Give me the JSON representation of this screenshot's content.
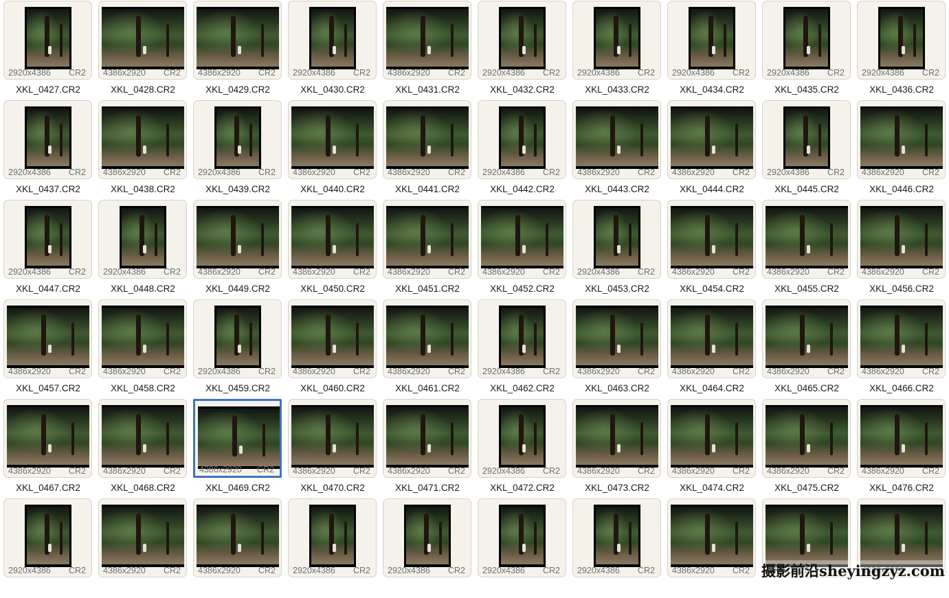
{
  "items": [
    {
      "filename": "XKL_0427.CR2",
      "dimensions": "2920x4386",
      "format": "CR2",
      "orientation": "portrait",
      "selected": false
    },
    {
      "filename": "XKL_0428.CR2",
      "dimensions": "4386x2920",
      "format": "CR2",
      "orientation": "landscape",
      "selected": false
    },
    {
      "filename": "XKL_0429.CR2",
      "dimensions": "4386x2920",
      "format": "CR2",
      "orientation": "landscape",
      "selected": false
    },
    {
      "filename": "XKL_0430.CR2",
      "dimensions": "2920x4386",
      "format": "CR2",
      "orientation": "portrait",
      "selected": false
    },
    {
      "filename": "XKL_0431.CR2",
      "dimensions": "4386x2920",
      "format": "CR2",
      "orientation": "landscape",
      "selected": false
    },
    {
      "filename": "XKL_0432.CR2",
      "dimensions": "2920x4386",
      "format": "CR2",
      "orientation": "portrait",
      "selected": false
    },
    {
      "filename": "XKL_0433.CR2",
      "dimensions": "2920x4386",
      "format": "CR2",
      "orientation": "portrait",
      "selected": false
    },
    {
      "filename": "XKL_0434.CR2",
      "dimensions": "2920x4386",
      "format": "CR2",
      "orientation": "portrait",
      "selected": false
    },
    {
      "filename": "XKL_0435.CR2",
      "dimensions": "2920x4386",
      "format": "CR2",
      "orientation": "portrait",
      "selected": false
    },
    {
      "filename": "XKL_0436.CR2",
      "dimensions": "2920x4386",
      "format": "CR2",
      "orientation": "portrait",
      "selected": false
    },
    {
      "filename": "XKL_0437.CR2",
      "dimensions": "2920x4386",
      "format": "CR2",
      "orientation": "portrait",
      "selected": false
    },
    {
      "filename": "XKL_0438.CR2",
      "dimensions": "4386x2920",
      "format": "CR2",
      "orientation": "landscape",
      "selected": false
    },
    {
      "filename": "XKL_0439.CR2",
      "dimensions": "2920x4386",
      "format": "CR2",
      "orientation": "portrait",
      "selected": false
    },
    {
      "filename": "XKL_0440.CR2",
      "dimensions": "4386x2920",
      "format": "CR2",
      "orientation": "landscape",
      "selected": false
    },
    {
      "filename": "XKL_0441.CR2",
      "dimensions": "4386x2920",
      "format": "CR2",
      "orientation": "landscape",
      "selected": false
    },
    {
      "filename": "XKL_0442.CR2",
      "dimensions": "2920x4386",
      "format": "CR2",
      "orientation": "portrait",
      "selected": false
    },
    {
      "filename": "XKL_0443.CR2",
      "dimensions": "4386x2920",
      "format": "CR2",
      "orientation": "landscape",
      "selected": false
    },
    {
      "filename": "XKL_0444.CR2",
      "dimensions": "4386x2920",
      "format": "CR2",
      "orientation": "landscape",
      "selected": false
    },
    {
      "filename": "XKL_0445.CR2",
      "dimensions": "2920x4386",
      "format": "CR2",
      "orientation": "portrait",
      "selected": false
    },
    {
      "filename": "XKL_0446.CR2",
      "dimensions": "4386x2920",
      "format": "CR2",
      "orientation": "landscape",
      "selected": false
    },
    {
      "filename": "XKL_0447.CR2",
      "dimensions": "2920x4386",
      "format": "CR2",
      "orientation": "portrait",
      "selected": false
    },
    {
      "filename": "XKL_0448.CR2",
      "dimensions": "2920x4386",
      "format": "CR2",
      "orientation": "portrait",
      "selected": false
    },
    {
      "filename": "XKL_0449.CR2",
      "dimensions": "4386x2920",
      "format": "CR2",
      "orientation": "landscape",
      "selected": false
    },
    {
      "filename": "XKL_0450.CR2",
      "dimensions": "4386x2920",
      "format": "CR2",
      "orientation": "landscape",
      "selected": false
    },
    {
      "filename": "XKL_0451.CR2",
      "dimensions": "4386x2920",
      "format": "CR2",
      "orientation": "landscape",
      "selected": false
    },
    {
      "filename": "XKL_0452.CR2",
      "dimensions": "4386x2920",
      "format": "CR2",
      "orientation": "landscape",
      "selected": false
    },
    {
      "filename": "XKL_0453.CR2",
      "dimensions": "2920x4386",
      "format": "CR2",
      "orientation": "portrait",
      "selected": false
    },
    {
      "filename": "XKL_0454.CR2",
      "dimensions": "4386x2920",
      "format": "CR2",
      "orientation": "landscape",
      "selected": false
    },
    {
      "filename": "XKL_0455.CR2",
      "dimensions": "4386x2920",
      "format": "CR2",
      "orientation": "landscape",
      "selected": false
    },
    {
      "filename": "XKL_0456.CR2",
      "dimensions": "4386x2920",
      "format": "CR2",
      "orientation": "landscape",
      "selected": false
    },
    {
      "filename": "XKL_0457.CR2",
      "dimensions": "4386x2920",
      "format": "CR2",
      "orientation": "landscape",
      "selected": false
    },
    {
      "filename": "XKL_0458.CR2",
      "dimensions": "4386x2920",
      "format": "CR2",
      "orientation": "landscape",
      "selected": false
    },
    {
      "filename": "XKL_0459.CR2",
      "dimensions": "2920x4386",
      "format": "CR2",
      "orientation": "portrait",
      "selected": false
    },
    {
      "filename": "XKL_0460.CR2",
      "dimensions": "4386x2920",
      "format": "CR2",
      "orientation": "landscape",
      "selected": false
    },
    {
      "filename": "XKL_0461.CR2",
      "dimensions": "4386x2920",
      "format": "CR2",
      "orientation": "landscape",
      "selected": false
    },
    {
      "filename": "XKL_0462.CR2",
      "dimensions": "2920x4386",
      "format": "CR2",
      "orientation": "portrait",
      "selected": false
    },
    {
      "filename": "XKL_0463.CR2",
      "dimensions": "4386x2920",
      "format": "CR2",
      "orientation": "landscape",
      "selected": false
    },
    {
      "filename": "XKL_0464.CR2",
      "dimensions": "4386x2920",
      "format": "CR2",
      "orientation": "landscape",
      "selected": false
    },
    {
      "filename": "XKL_0465.CR2",
      "dimensions": "4386x2920",
      "format": "CR2",
      "orientation": "landscape",
      "selected": false
    },
    {
      "filename": "XKL_0466.CR2",
      "dimensions": "4386x2920",
      "format": "CR2",
      "orientation": "landscape",
      "selected": false
    },
    {
      "filename": "XKL_0467.CR2",
      "dimensions": "4386x2920",
      "format": "CR2",
      "orientation": "landscape",
      "selected": false
    },
    {
      "filename": "XKL_0468.CR2",
      "dimensions": "4386x2920",
      "format": "CR2",
      "orientation": "landscape",
      "selected": false
    },
    {
      "filename": "XKL_0469.CR2",
      "dimensions": "4386x2920",
      "format": "CR2",
      "orientation": "landscape",
      "selected": true
    },
    {
      "filename": "XKL_0470.CR2",
      "dimensions": "4386x2920",
      "format": "CR2",
      "orientation": "landscape",
      "selected": false
    },
    {
      "filename": "XKL_0471.CR2",
      "dimensions": "4386x2920",
      "format": "CR2",
      "orientation": "landscape",
      "selected": false
    },
    {
      "filename": "XKL_0472.CR2",
      "dimensions": "2920x4386",
      "format": "CR2",
      "orientation": "portrait",
      "selected": false
    },
    {
      "filename": "XKL_0473.CR2",
      "dimensions": "4386x2920",
      "format": "CR2",
      "orientation": "landscape",
      "selected": false
    },
    {
      "filename": "XKL_0474.CR2",
      "dimensions": "4386x2920",
      "format": "CR2",
      "orientation": "landscape",
      "selected": false
    },
    {
      "filename": "XKL_0475.CR2",
      "dimensions": "4386x2920",
      "format": "CR2",
      "orientation": "landscape",
      "selected": false
    },
    {
      "filename": "XKL_0476.CR2",
      "dimensions": "4386x2920",
      "format": "CR2",
      "orientation": "landscape",
      "selected": false
    },
    {
      "filename": "",
      "dimensions": "2920x4386",
      "format": "CR2",
      "orientation": "portrait",
      "selected": false
    },
    {
      "filename": "",
      "dimensions": "4386x2920",
      "format": "CR2",
      "orientation": "landscape",
      "selected": false
    },
    {
      "filename": "",
      "dimensions": "4386x2920",
      "format": "CR2",
      "orientation": "landscape",
      "selected": false
    },
    {
      "filename": "",
      "dimensions": "2920x4386",
      "format": "CR2",
      "orientation": "portrait",
      "selected": false
    },
    {
      "filename": "",
      "dimensions": "2920x4386",
      "format": "CR2",
      "orientation": "portrait",
      "selected": false
    },
    {
      "filename": "",
      "dimensions": "2920x4386",
      "format": "CR2",
      "orientation": "portrait",
      "selected": false
    },
    {
      "filename": "",
      "dimensions": "2920x4386",
      "format": "CR2",
      "orientation": "portrait",
      "selected": false
    },
    {
      "filename": "",
      "dimensions": "4386x2920",
      "format": "CR2",
      "orientation": "landscape",
      "selected": false
    },
    {
      "filename": "",
      "dimensions": "4386x2920",
      "format": "",
      "orientation": "landscape",
      "selected": false
    },
    {
      "filename": "",
      "dimensions": "4386x2920",
      "format": "",
      "orientation": "landscape",
      "selected": false
    }
  ],
  "watermark": "摄影前沿sheyingzyz.com",
  "colors": {
    "selection": "#3d74c4",
    "card_background": "#f4f2ea",
    "card_border": "#d6d3c7",
    "meta_text": "#6f6f6f"
  }
}
